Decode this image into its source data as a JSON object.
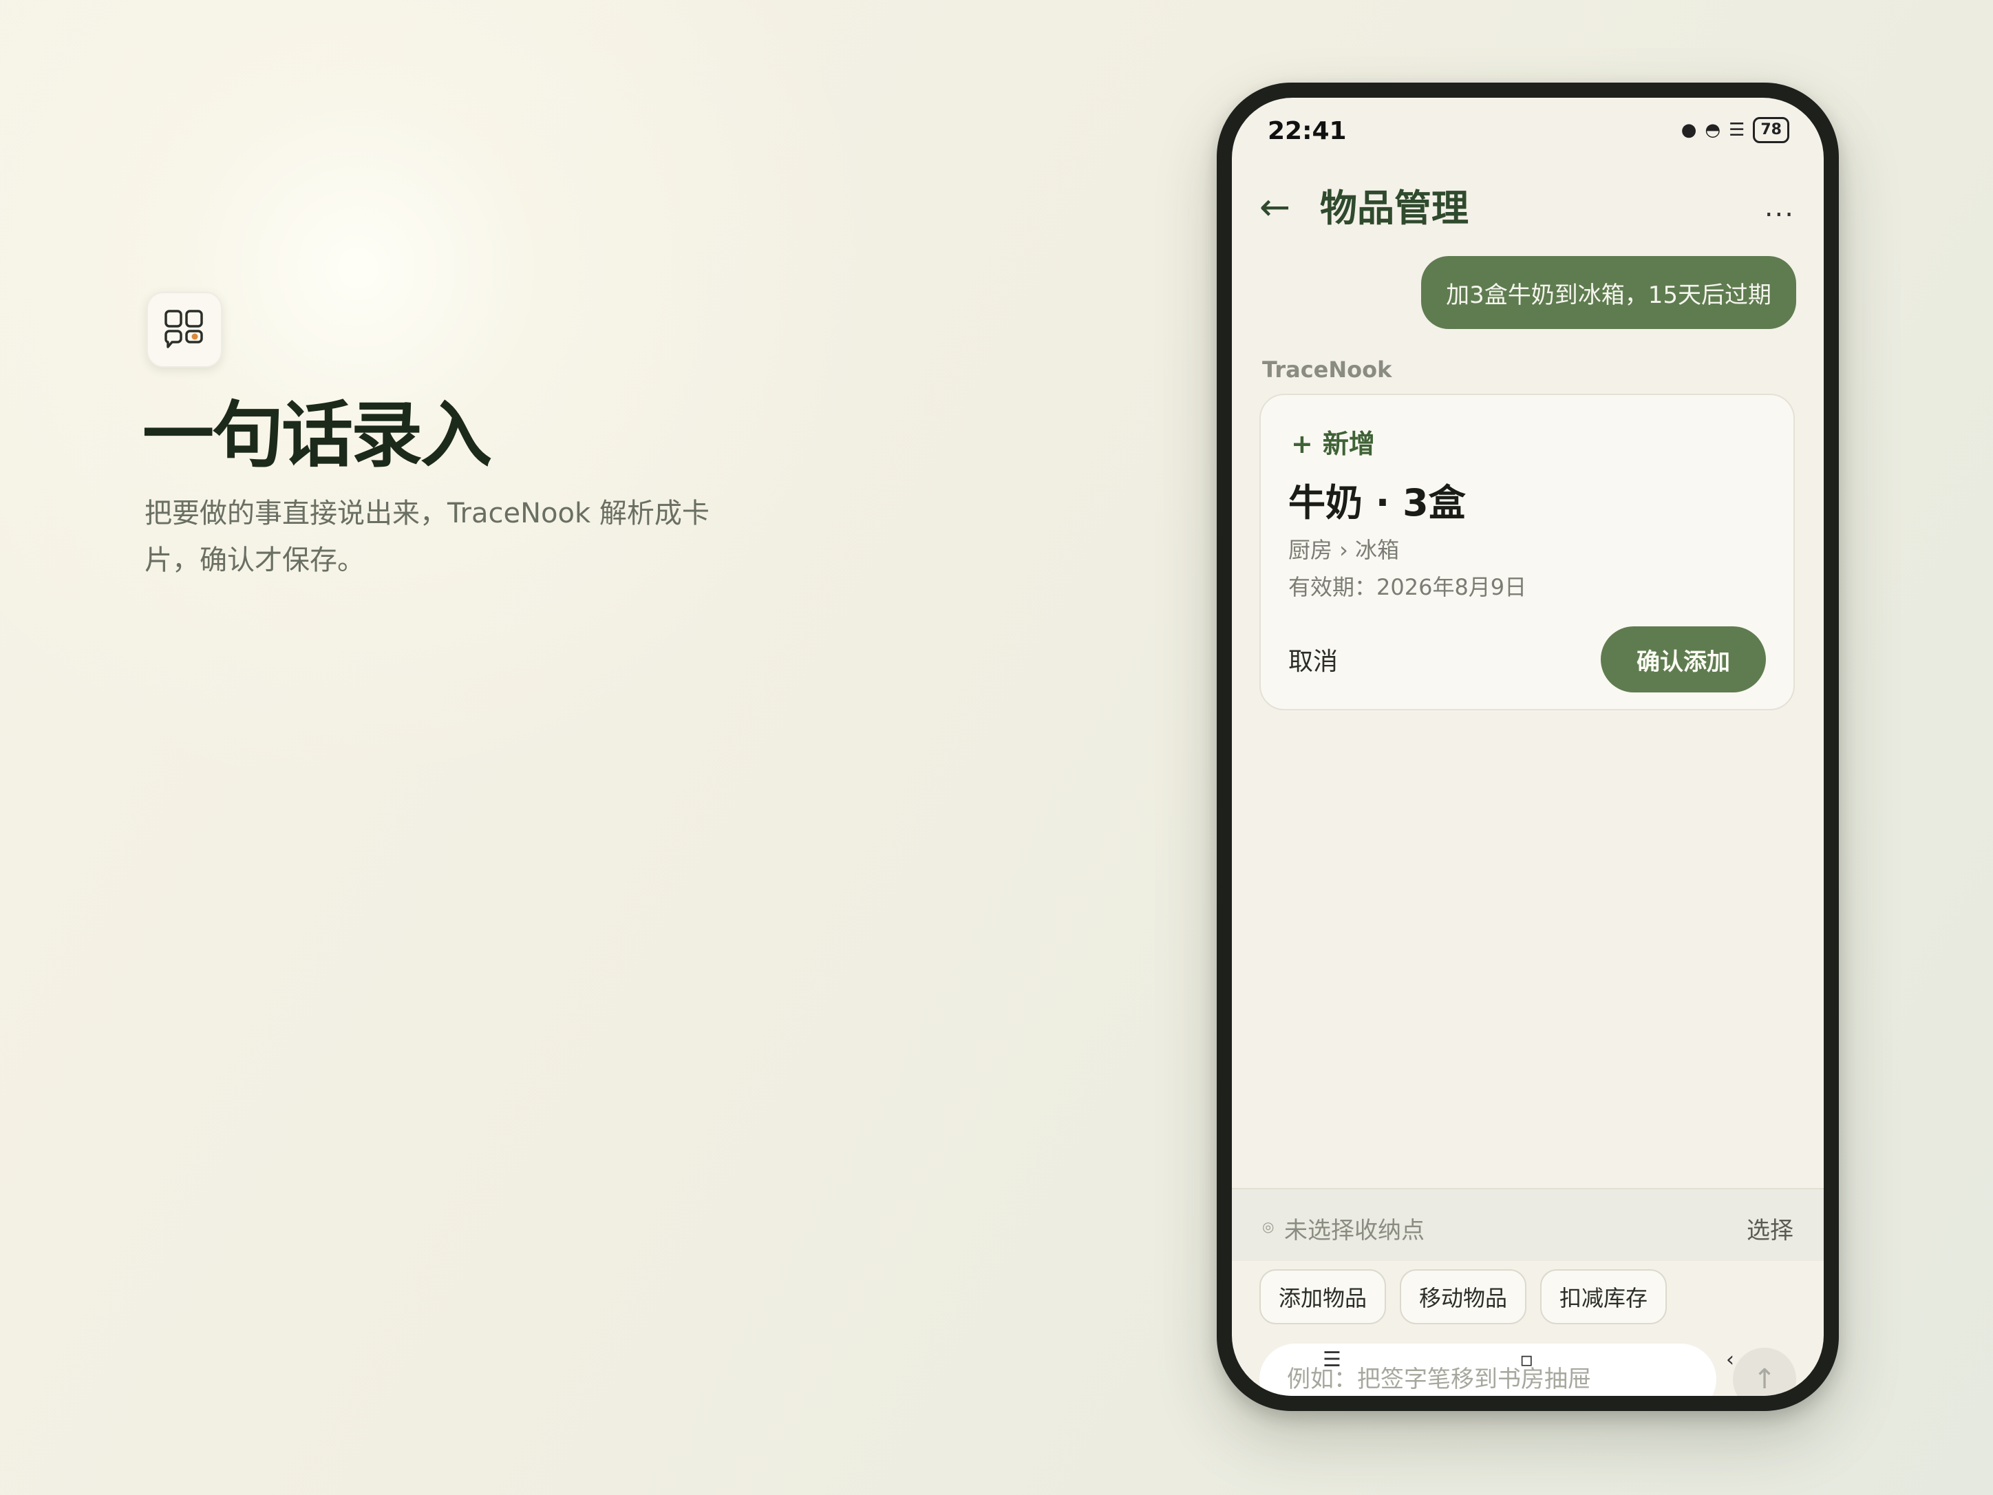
{
  "feature": {
    "icon": "chat-card-icon",
    "headline": "一句话录入",
    "description": "把要做的事直接说出来，TraceNook 解析成卡片，确认才保存。"
  },
  "status_bar": {
    "time": "22:41",
    "battery": "78"
  },
  "header": {
    "back_icon": "←",
    "title": "物品管理",
    "more_icon": "..."
  },
  "chat": {
    "user_message": "加3盒牛奶到冰箱，15天后过期",
    "bot_name": "TraceNook",
    "card": {
      "action_icon": "+",
      "action": "新增",
      "title": "牛奶 · 3盒",
      "location": "厨房 › 冰箱",
      "expiry": "有效期：2026年8月9日",
      "cancel_label": "取消",
      "confirm_label": "确认添加"
    }
  },
  "composer": {
    "storage_status": "未选择收纳点",
    "storage_select_label": "选择",
    "chips": [
      "添加物品",
      "移动物品",
      "扣减库存"
    ],
    "input_placeholder": "例如：把签字笔移到书房抽屉",
    "send_icon": "↑"
  },
  "system_nav": {
    "menu": "☰",
    "home": "▫",
    "back": "‹"
  },
  "colors": {
    "accent": "#5f7c50",
    "title_green": "#2f4a2d",
    "screen_bg": "#f4f1e9"
  }
}
